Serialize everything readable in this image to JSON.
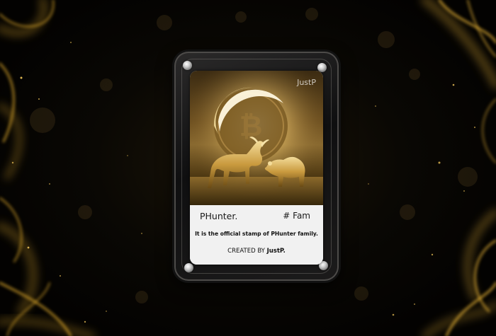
{
  "card": {
    "artist_mark": "JustP",
    "title": "PHunter.",
    "tag": "# Fam",
    "description": "It is the official stamp of PHunter family.",
    "credit_prefix": "CREATED BY",
    "credit_name": "JustP."
  },
  "colors": {
    "background": "#050402",
    "gold": "#d9a933",
    "card_panel": "#f1f1f1",
    "frame": "#1c1b1b"
  },
  "icons": {
    "artwork": "bull-and-bear-with-coin"
  }
}
